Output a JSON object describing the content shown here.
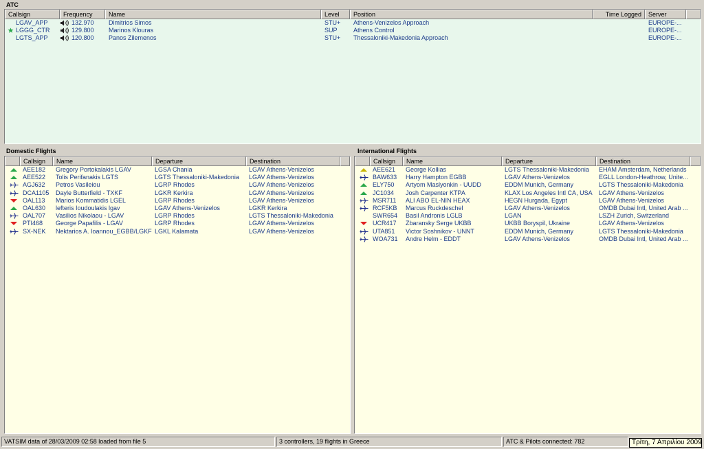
{
  "colors": {
    "atc_bg": "#e8f7ec",
    "flight_bg": "#ffffe6",
    "text_blue": "#1a3a8a",
    "arrow_up": "#2aa84a",
    "arrow_down": "#e02020",
    "arrow_yellow": "#c8b400",
    "plane": "#1a2a8a"
  },
  "atc": {
    "title": "ATC",
    "columns": [
      "Callsign",
      "Frequency",
      "Name",
      "Level",
      "Position",
      "Time Logged",
      "Server"
    ],
    "rows": [
      {
        "star": false,
        "callsign": "LGAV_APP",
        "frequency": "132.970",
        "name": "Dimitrios Simos",
        "level": "STU+",
        "position": "Athens-Venizelos Approach",
        "time": "",
        "server": "EUROPE-..."
      },
      {
        "star": true,
        "star_icon": "star-icon",
        "callsign": "LGGG_CTR",
        "frequency": "129.800",
        "name": "Marinos Klouras",
        "level": "SUP",
        "position": "Athens Control",
        "time": "",
        "server": "EUROPE-..."
      },
      {
        "star": false,
        "callsign": "LGTS_APP",
        "frequency": "120.800",
        "name": "Panos Zilemenos",
        "level": "STU+",
        "position": "Thessaloniki-Makedonia Approach",
        "time": "",
        "server": "EUROPE-..."
      }
    ]
  },
  "domestic": {
    "title": "Domestic Flights",
    "columns": [
      "Callsign",
      "Name",
      "Departure",
      "Destination"
    ],
    "rows": [
      {
        "icon": "up",
        "callsign": "AEE182",
        "name": "Gregory Portokalakis LGAV",
        "departure": "LGSA Chania",
        "destination": "LGAV Athens-Venizelos"
      },
      {
        "icon": "up",
        "callsign": "AEE522",
        "name": "Tolis Perifanakis LGTS",
        "departure": "LGTS Thessaloniki-Makedonia",
        "destination": "LGAV Athens-Venizelos"
      },
      {
        "icon": "plane",
        "callsign": "AGJ632",
        "name": "Petros Vasileiou",
        "departure": "LGRP Rhodes",
        "destination": "LGAV Athens-Venizelos"
      },
      {
        "icon": "plane",
        "callsign": "DCA1105",
        "name": "Dayle Butterfield - TXKF",
        "departure": "LGKR Kerkira",
        "destination": "LGAV Athens-Venizelos"
      },
      {
        "icon": "down",
        "callsign": "OAL113",
        "name": "Marios Kommatidis LGEL",
        "departure": "LGRP Rhodes",
        "destination": "LGAV Athens-Venizelos"
      },
      {
        "icon": "up",
        "callsign": "OAL630",
        "name": "lefteris Ioudoulakis lgav",
        "departure": "LGAV Athens-Venizelos",
        "destination": "LGKR Kerkira"
      },
      {
        "icon": "plane",
        "callsign": "OAL707",
        "name": "Vasilios Nikolaou - LGAV",
        "departure": "LGRP Rhodes",
        "destination": "LGTS Thessaloniki-Makedonia"
      },
      {
        "icon": "down",
        "callsign": "PTI468",
        "name": "George Papafilis - LGAV",
        "departure": "LGRP Rhodes",
        "destination": "LGAV Athens-Venizelos"
      },
      {
        "icon": "plane",
        "callsign": "SX-NEK",
        "name": "Nektarios A. Ioannou_EGBB/LGKF",
        "departure": "LGKL Kalamata",
        "destination": "LGAV Athens-Venizelos"
      }
    ]
  },
  "international": {
    "title": "International Flights",
    "columns": [
      "Callsign",
      "Name",
      "Departure",
      "Destination"
    ],
    "rows": [
      {
        "icon": "yellow",
        "callsign": "AEE621",
        "name": "George Kollias",
        "departure": "LGTS Thessaloniki-Makedonia",
        "destination": "EHAM Amsterdam, Netherlands"
      },
      {
        "icon": "plane",
        "callsign": "BAW633",
        "name": "Harry Hampton EGBB",
        "departure": "LGAV Athens-Venizelos",
        "destination": "EGLL London-Heathrow, Unite..."
      },
      {
        "icon": "up",
        "callsign": "ELY750",
        "name": "Artyom Maslyonkin - UUDD",
        "departure": "EDDM Munich, Germany",
        "destination": "LGTS Thessaloniki-Makedonia"
      },
      {
        "icon": "up",
        "callsign": "JC1034",
        "name": "Josh Carpenter KTPA",
        "departure": "KLAX Los Angeles Intl CA, USA",
        "destination": "LGAV Athens-Venizelos"
      },
      {
        "icon": "plane",
        "callsign": "MSR711",
        "name": "ALI ABO EL-NIN HEAX",
        "departure": "HEGN Hurgada, Egypt",
        "destination": "LGAV Athens-Venizelos"
      },
      {
        "icon": "plane",
        "callsign": "RCF5KB",
        "name": "Marcus Ruckdeschel",
        "departure": "LGAV Athens-Venizelos",
        "destination": "OMDB Dubai Intl, United Arab ..."
      },
      {
        "icon": "none",
        "callsign": "SWR654",
        "name": "Basil Andronis LGLB",
        "departure": "LGAN",
        "destination": "LSZH Zurich, Switzerland"
      },
      {
        "icon": "down",
        "callsign": "UCR417",
        "name": "Zbaransky Serge UKBB",
        "departure": "UKBB Boryspil, Ukraine",
        "destination": "LGAV Athens-Venizelos"
      },
      {
        "icon": "plane",
        "callsign": "UTA851",
        "name": "Victor Soshnikov - UNNT",
        "departure": "EDDM Munich, Germany",
        "destination": "LGTS Thessaloniki-Makedonia"
      },
      {
        "icon": "plane",
        "callsign": "WOA731",
        "name": "Andre Helm - EDDT",
        "departure": "LGAV Athens-Venizelos",
        "destination": "OMDB Dubai Intl, United Arab ..."
      }
    ]
  },
  "status": {
    "left": "VATSIM data of 28/03/2009 02:58 loaded from file 5",
    "middle": "3 controllers, 19 flights in Greece",
    "right": "ATC & Pilots connected: 782",
    "clock": "Τρίτη, 7 Απριλίου 2009"
  }
}
